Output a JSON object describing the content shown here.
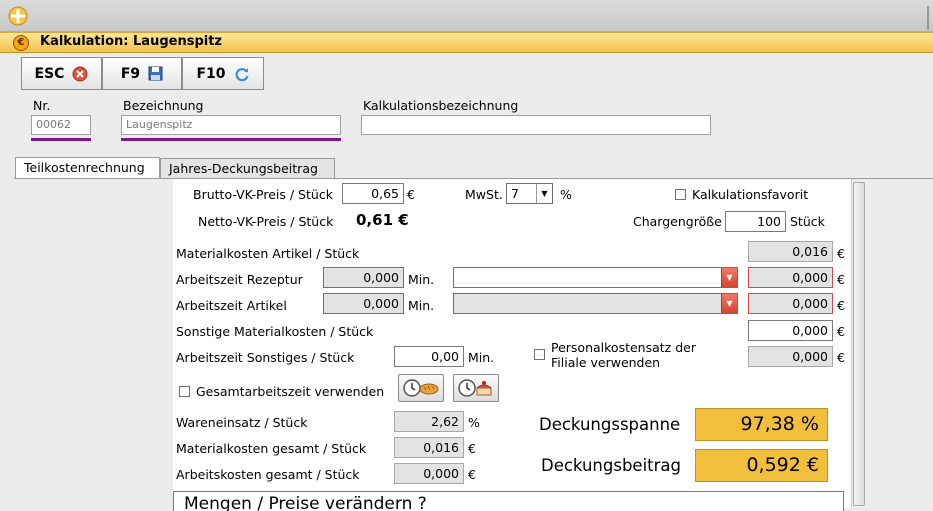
{
  "window": {
    "title": "Kalkulation: Laugenspitz"
  },
  "toolbar": {
    "esc_label": "ESC",
    "f9_label": "F9",
    "f10_label": "F10"
  },
  "header": {
    "nr_label": "Nr.",
    "nr_value": "00062",
    "bezeichnung_label": "Bezeichnung",
    "bezeichnung_value": "Laugenspitz",
    "kalkbez_label": "Kalkulationsbezeichnung",
    "kalkbez_value": ""
  },
  "tabs": [
    {
      "label": "Teilkostenrechnung",
      "active": true
    },
    {
      "label": "Jahres-Deckungsbeitrag",
      "active": false
    }
  ],
  "form": {
    "brutto_label": "Brutto-VK-Preis / Stück",
    "brutto_value": "0,65",
    "euro": "€",
    "mwst_label": "MwSt.",
    "mwst_value": "7",
    "percent": "%",
    "favorit_label": "Kalkulationsfavorit",
    "netto_label": "Netto-VK-Preis / Stück",
    "netto_value": "0,61 €",
    "charge_label": "Chargengröße",
    "charge_value": "100",
    "charge_unit": "Stück",
    "material_artikel_label": "Materialkosten Artikel / Stück",
    "material_artikel_value": "0,016",
    "az_rezeptur_label": "Arbeitszeit Rezeptur",
    "az_rezeptur_value": "0,000",
    "az_rezeptur_cost": "0,000",
    "min": "Min.",
    "az_artikel_label": "Arbeitszeit Artikel",
    "az_artikel_value": "0,000",
    "az_artikel_cost": "0,000",
    "sonst_material_label": "Sonstige Materialkosten / Stück",
    "sonst_material_value": "0,000",
    "az_sonst_label": "Arbeitszeit Sonstiges / Stück",
    "az_sonst_value": "0,00",
    "az_sonst_cost": "0,000",
    "personal_label": "Personalkostensatz der Filiale verwenden",
    "gesamtzeit_label": "Gesamtarbeitszeit verwenden",
    "wareneinsatz_label": "Wareneinsatz / Stück",
    "wareneinsatz_value": "2,62",
    "material_gesamt_label": "Materialkosten gesamt / Stück",
    "material_gesamt_value": "0,016",
    "arbeit_gesamt_label": "Arbeitskosten gesamt / Stück",
    "arbeit_gesamt_value": "0,000"
  },
  "kpi": {
    "spanne_label": "Deckungsspanne",
    "spanne_value": "97,38 %",
    "beitrag_label": "Deckungsbeitrag",
    "beitrag_value": "0,592 €"
  },
  "bottom": {
    "text": "Mengen / Preise verändern ?"
  },
  "colors": {
    "accent": "#f2bf3d",
    "title_bar": "#f1c24a",
    "purple": "#7a1a8a",
    "error_red": "#d04a4a"
  }
}
